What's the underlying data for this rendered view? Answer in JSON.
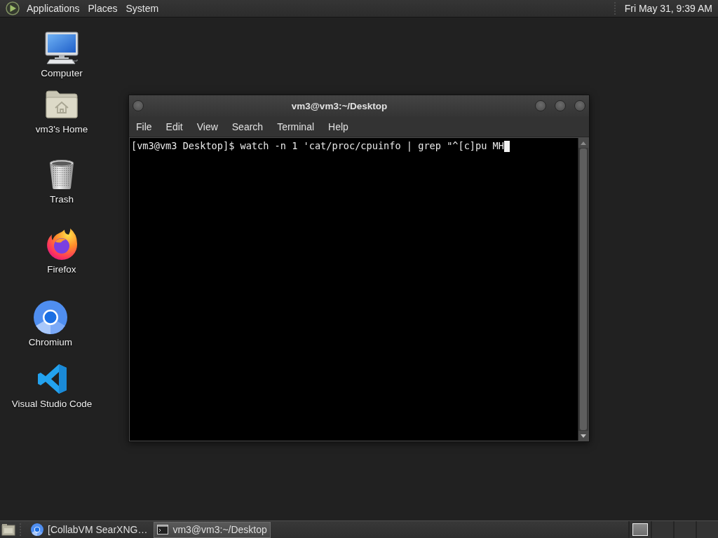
{
  "top_panel": {
    "menus": [
      {
        "label": "Applications"
      },
      {
        "label": "Places"
      },
      {
        "label": "System"
      }
    ],
    "clock": "Fri May 31, 9:39 AM"
  },
  "desktop_icons": [
    {
      "label": "Computer",
      "kind": "computer"
    },
    {
      "label": "vm3's Home",
      "kind": "home"
    },
    {
      "label": "Trash",
      "kind": "trash"
    },
    {
      "label": "Firefox",
      "kind": "firefox"
    },
    {
      "label": "Chromium",
      "kind": "chromium"
    },
    {
      "label": "Visual Studio Code",
      "kind": "vscode"
    }
  ],
  "terminal_window": {
    "title": "vm3@vm3:~/Desktop",
    "menus": [
      "File",
      "Edit",
      "View",
      "Search",
      "Terminal",
      "Help"
    ],
    "lines": [
      "[vm3@vm3 Desktop]$ watch -n 1 'cat/proc/cpuinfo | grep \"^[c]pu MH"
    ]
  },
  "taskbar": {
    "tasks": [
      {
        "label": "[CollabVM SearXNG…",
        "kind": "browser",
        "selected": false
      },
      {
        "label": "vm3@vm3:~/Desktop",
        "kind": "terminal",
        "selected": true
      }
    ]
  }
}
